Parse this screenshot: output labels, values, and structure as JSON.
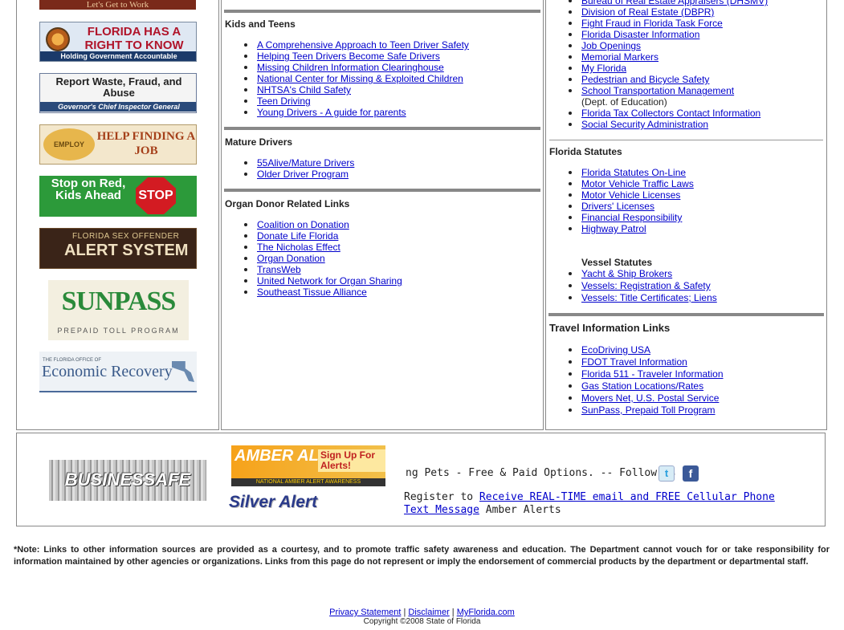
{
  "banners": {
    "get_to_work": "Let's Get to Work",
    "florida_right_to_know_line1": "FLORIDA HAS A RIGHT TO KNOW",
    "florida_right_to_know_line2": "Holding Government Accountable",
    "report_waste_line1": "Report Waste, Fraud, and Abuse",
    "report_waste_line2": "Governor's Chief Inspector General",
    "employ_florida_logo": "EMPLOY FLORIDA",
    "employ_florida_text": "HELP FINDING A JOB",
    "stop_on_red_text": "Stop on Red, Kids Ahead",
    "stop_sign": "STOP",
    "sex_offender_line1": "FLORIDA SEX OFFENDER",
    "sex_offender_line2": "ALERT SYSTEM",
    "sunpass_line1": "SUNPASS",
    "sunpass_line2": "PREPAID TOLL PROGRAM",
    "econ_recovery_line1": "THE FLORIDA OFFICE OF",
    "econ_recovery_line2": "Economic Recovery",
    "business_safe": "BUSINESSAFE",
    "amber_alert": "AMBER ALERT",
    "amber_signup": "Sign Up For Alerts!",
    "amber_footer": "NATIONAL AMBER ALERT AWARENESS",
    "silver_alert": "Silver Alert"
  },
  "middle": {
    "kids_title": "Kids and Teens",
    "kids_links": [
      "A Comprehensive Approach to Teen Driver Safety",
      "Helping Teen Drivers Become Safe Drivers",
      "Missing Children Information Clearinghouse",
      "National Center for Missing & Exploited Children",
      "NHTSA's Child Safety",
      "Teen Driving",
      "Young Drivers - A guide for parents"
    ],
    "mature_title": "Mature Drivers",
    "mature_links": [
      "55Alive/Mature Drivers",
      "Older Driver Program"
    ],
    "organ_title": "Organ Donor Related Links",
    "organ_links": [
      "Coalition on Donation",
      "Donate Life Florida",
      "The Nicholas Effect",
      "Organ Donation",
      "TransWeb",
      "United Network for Organ Sharing",
      "Southeast Tissue Alliance"
    ]
  },
  "right": {
    "top_links": [
      "Bureau of Real Estate Appraisers (DHSMV)",
      "Division of Real Estate (DBPR)",
      "Fight Fraud in Florida Task Force",
      "Florida Disaster Information",
      "Job Openings",
      "Memorial Markers",
      "My Florida",
      "Pedestrian and Bicycle Safety",
      "School Transportation Management"
    ],
    "school_note": "(Dept. of Education)",
    "top_links_2": [
      "Florida Tax Collectors Contact Information",
      "Social Security Administration"
    ],
    "statutes_title": "Florida Statutes",
    "statutes_links": [
      "Florida Statutes On-Line",
      "Motor Vehicle Traffic Laws",
      "Motor Vehicle Licenses",
      "Drivers' Licenses",
      "Financial Responsibility",
      "Highway Patrol"
    ],
    "vessel_title": "Vessel Statutes",
    "vessel_links": [
      "Yacht & Ship Brokers",
      "Vessels: Registration & Safety",
      "Vessels: Title Certificates; Liens"
    ],
    "travel_title": "Travel Information Links",
    "travel_links": [
      "EcoDriving USA",
      "FDOT Travel Information",
      "Florida 511 - Traveler Information",
      "Gas Station Locations/Rates",
      "Movers Net, U.S. Postal Service",
      "SunPass, Prepaid Toll Program"
    ]
  },
  "bottom": {
    "ticker": "ng Pets - Free & Paid Options. -- Follow us on",
    "register_prefix": "Register to",
    "register_link": "Receive REAL-TIME email and FREE Cellular Phone Text Message",
    "register_suffix": "Amber Alerts",
    "twitter_glyph": "t",
    "facebook_glyph": "f"
  },
  "note": "*Note:  Links to other information sources are provided as a courtesy, and to promote traffic safety awareness and education. The Department cannot vouch for or take responsibility for information maintained by other agencies or organizations. Links from this page do not represent or imply the endorsement of commercial products by the department or departmental staff.",
  "footer": {
    "privacy": "Privacy Statement",
    "disclaimer": "Disclaimer",
    "myflorida": "MyFlorida.com",
    "separator": "|",
    "copyright": "Copyright ©2008 State of Florida"
  }
}
